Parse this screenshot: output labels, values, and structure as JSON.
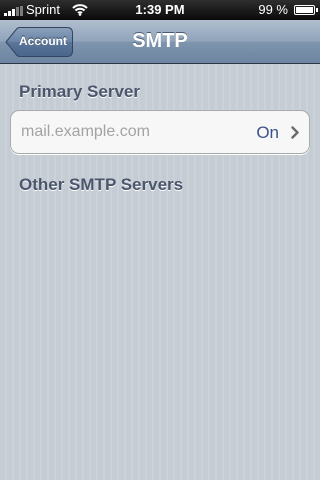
{
  "status_bar": {
    "carrier": "Sprint",
    "time": "1:39 PM",
    "battery_percent": "99 %",
    "battery_level": 0.99,
    "signal_bars": 3,
    "signal_icon": "signal-strength-icon",
    "wifi_icon": "wifi-icon",
    "battery_icon": "battery-icon"
  },
  "nav": {
    "back_label": "Account",
    "title": "SMTP"
  },
  "primary": {
    "header": "Primary Server",
    "server": {
      "name": "mail.example.com",
      "status": "On",
      "chevron_icon": "chevron-right-icon"
    }
  },
  "other": {
    "header": "Other SMTP Servers"
  },
  "colors": {
    "background": "#c5ccd4",
    "nav_bar": "#6d85a2",
    "section_header": "#4c566c",
    "value_text": "#385487",
    "placeholder_text": "#a3a3a3"
  }
}
